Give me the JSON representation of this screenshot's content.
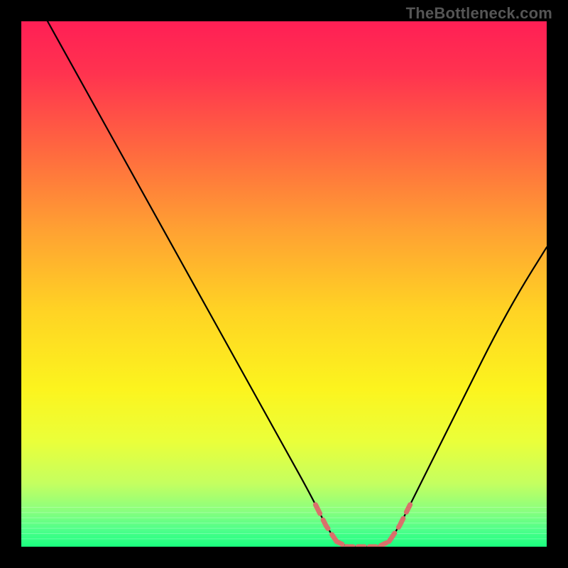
{
  "watermark": "TheBottleneck.com",
  "chart_data": {
    "type": "line",
    "title": "",
    "xlabel": "",
    "ylabel": "",
    "xlim": [
      0,
      100
    ],
    "ylim": [
      0,
      100
    ],
    "series": [
      {
        "name": "bottleneck-curve",
        "color": "#000000",
        "x": [
          5,
          10,
          15,
          20,
          25,
          30,
          35,
          40,
          45,
          50,
          55,
          58,
          60,
          62,
          65,
          68,
          70,
          72,
          75,
          80,
          85,
          90,
          95,
          100
        ],
        "y": [
          100,
          91,
          82,
          73,
          64,
          55,
          46,
          37,
          28,
          19,
          10,
          4,
          1,
          0,
          0,
          0,
          1,
          4,
          10,
          20,
          30,
          40,
          49,
          57
        ]
      },
      {
        "name": "bottleneck-zone-markers",
        "color": "#d9706b",
        "x_ranges": [
          [
            56,
            60
          ],
          [
            60,
            70
          ],
          [
            70,
            74
          ]
        ],
        "note": "pink dashed segment overlay near bottom valley"
      }
    ],
    "gradient_stops": [
      {
        "offset": 0.0,
        "color": "#ff1f55"
      },
      {
        "offset": 0.1,
        "color": "#ff334f"
      },
      {
        "offset": 0.25,
        "color": "#ff6a3f"
      },
      {
        "offset": 0.4,
        "color": "#ffa232"
      },
      {
        "offset": 0.55,
        "color": "#ffd324"
      },
      {
        "offset": 0.7,
        "color": "#fcf41e"
      },
      {
        "offset": 0.8,
        "color": "#eaff3a"
      },
      {
        "offset": 0.88,
        "color": "#c4ff60"
      },
      {
        "offset": 0.93,
        "color": "#8cff7d"
      },
      {
        "offset": 0.97,
        "color": "#4bff8a"
      },
      {
        "offset": 1.0,
        "color": "#1aff7e"
      }
    ],
    "green_band_lines_y": [
      92.5,
      93.5,
      94.5,
      95.5,
      96.5,
      97.5,
      98.5
    ]
  }
}
